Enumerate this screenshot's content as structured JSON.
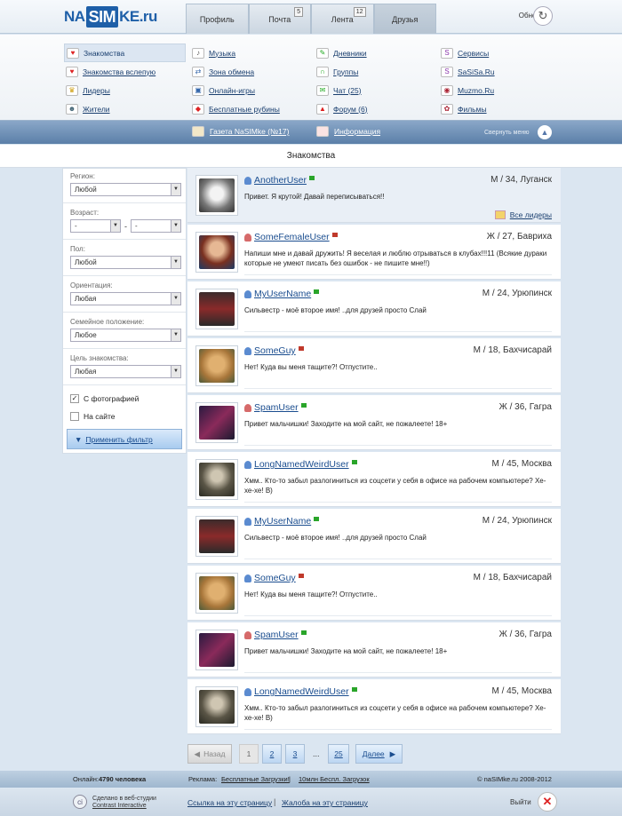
{
  "logo": {
    "pre": "NA",
    "sim": "SIM",
    "post": "KE.ru"
  },
  "tabs": [
    {
      "label": "Профиль",
      "badge": ""
    },
    {
      "label": "Почта",
      "badge": "5"
    },
    {
      "label": "Лента",
      "badge": "12"
    },
    {
      "label": "Друзья",
      "badge": ""
    }
  ],
  "refresh_label": "Обновить",
  "menu": {
    "col1": [
      "Знакомства",
      "Знакомства вслепую",
      "Лидеры",
      "Жители"
    ],
    "col2": [
      "Музыка",
      "Зона обмена",
      "Онлайн-игры",
      "Бесплатные рубины"
    ],
    "col3": [
      "Дневники",
      "Группы",
      "Чат (25)",
      "Форум (6)"
    ],
    "col4": [
      "Сервисы",
      "SaSiSa.Ru",
      "Muzmo.Ru",
      "Фильмы"
    ]
  },
  "subbar": {
    "newspaper": "Газета NaSIMke (№17)",
    "info": "Информация",
    "collapse": "Свернуть меню"
  },
  "page_title": "Знакомства",
  "filter": {
    "region_label": "Регион:",
    "region_value": "Любой",
    "age_label": "Возраст:",
    "age_from": "-",
    "age_dash": "-",
    "age_to": "-",
    "sex_label": "Пол:",
    "sex_value": "Любой",
    "orientation_label": "Ориентация:",
    "orientation_value": "Любая",
    "family_label": "Семейное положение:",
    "family_value": "Любое",
    "goal_label": "Цель знакомства:",
    "goal_value": "Любая",
    "with_photo": "С фотографией",
    "with_photo_checked": "✓",
    "online": "На сайте",
    "apply": "Применить фильтр"
  },
  "leaders_link": "Все лидеры",
  "users": [
    {
      "name": "AnotherUser",
      "info": "М / 34, Луганск",
      "msg": "Привет. Я крутой! Давай переписываться!!",
      "gender": "m",
      "status": "green",
      "av": "a1"
    },
    {
      "name": "SomeFemaleUser",
      "info": "Ж / 27, Бавриха",
      "msg": "Напиши мне и давай дружить! Я веселая и люблю отрываться в клубах!!!11 (Всякие дураки которые не умеют писать без ошибок - не пишите мне!!)",
      "gender": "f",
      "status": "red",
      "av": "a2"
    },
    {
      "name": "MyUserName",
      "info": "М / 24, Урюпинск",
      "msg": "Сильвестр - моё второе имя! ..для друзей просто Слай",
      "gender": "m",
      "status": "green",
      "av": "a3"
    },
    {
      "name": "SomeGuy",
      "info": "М / 18, Бахчисарай",
      "msg": "Нет! Куда вы меня тащите?! Отпустите..",
      "gender": "m",
      "status": "red",
      "av": "a4"
    },
    {
      "name": "SpamUser",
      "info": "Ж / 36, Гагра",
      "msg": "Привет мальчишки! Заходите на мой сайт, не пожалеете! 18+",
      "gender": "f",
      "status": "green",
      "av": "a5"
    },
    {
      "name": "LongNamedWeirdUser",
      "info": "М / 45, Москва",
      "msg": "Хмм.. Кто-то забыл разлогиниться из соцсети у себя в офисе  на рабочем компьютере? Хе-хе-хе! В)",
      "gender": "m",
      "status": "green",
      "av": "a6"
    },
    {
      "name": "MyUserName",
      "info": "М / 24, Урюпинск",
      "msg": "Сильвестр - моё второе имя! ..для друзей просто Слай",
      "gender": "m",
      "status": "green",
      "av": "a3"
    },
    {
      "name": "SomeGuy",
      "info": "М / 18, Бахчисарай",
      "msg": "Нет! Куда вы меня тащите?! Отпустите..",
      "gender": "m",
      "status": "red",
      "av": "a4"
    },
    {
      "name": "SpamUser",
      "info": "Ж / 36, Гагра",
      "msg": "Привет мальчишки! Заходите на мой сайт, не пожалеете! 18+",
      "gender": "f",
      "status": "green",
      "av": "a5"
    },
    {
      "name": "LongNamedWeirdUser",
      "info": "М / 45, Москва",
      "msg": "Хмм.. Кто-то забыл разлогиниться из соцсети у себя в офисе  на рабочем компьютере? Хе-хе-хе! В)",
      "gender": "m",
      "status": "green",
      "av": "a6"
    }
  ],
  "pager": {
    "back": "Назад",
    "p1": "1",
    "p2": "2",
    "p3": "3",
    "ellipsis": "...",
    "last": "25",
    "next": "Далее"
  },
  "footer": {
    "online_label": "Онлайн:",
    "online_count": "4790 человека",
    "ads_label": "Реклама:",
    "ad1": "Бесплатные Загрузки!",
    "sep": "|",
    "ad2": "10млн Беспл. Загрузок",
    "copyright": "© naSIMke.ru 2008-2012",
    "studio_line1": "Сделано в веб-студии",
    "studio_line2": "Contrast Interactive",
    "link_page": "Ссылка на эту страницу",
    "complaint": "Жалоба на эту страницу",
    "logout": "Выйти"
  },
  "colors": {
    "accent": "#1e5fa8",
    "link": "#1a4d8f",
    "bar": "#5b7fa8",
    "online": "#2aa52a",
    "offline": "#c0392b"
  }
}
